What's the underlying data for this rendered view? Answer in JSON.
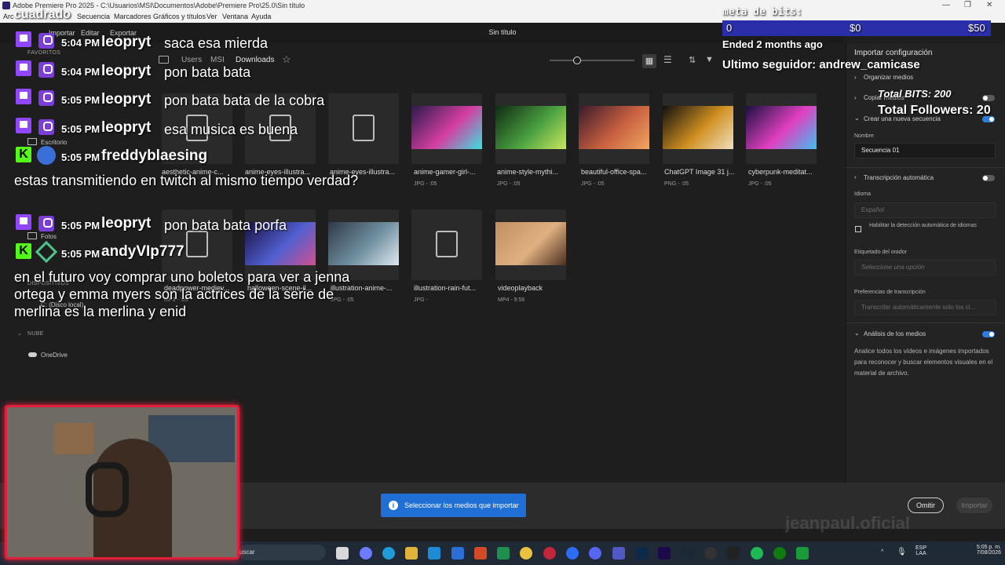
{
  "window": {
    "title": "Adobe Premiere Pro 2025 - C:\\Usuarios\\MSI\\Documentos\\Adobe\\Premiere Pro\\25.0\\Sin título",
    "doc_title": "Sin título",
    "minimize": "—",
    "maximize": "❐",
    "close": "✕"
  },
  "menubar": {
    "items": [
      "Arc",
      "Secuencia",
      "Marcadores",
      "Gráficos y títulos",
      "Ver",
      "Ventana",
      "Ayuda"
    ]
  },
  "tabs": [
    "Importar",
    "Editar",
    "Exportar"
  ],
  "sidebar": {
    "favorites_label": "FAVORITOS",
    "items": [
      "Escritorio",
      "Fotos"
    ],
    "devices_label": "DISPOSITIVOS",
    "device": "C: (Disco local)",
    "cloud_label": "NUBE",
    "cloud_item": "OneDrive"
  },
  "breadcrumb": [
    "Users",
    "MSI",
    "Downloads"
  ],
  "files": [
    {
      "name": "aesthetic-anime-c...",
      "meta": "",
      "kind": "doc"
    },
    {
      "name": "anime-eyes-illustra...",
      "meta": "",
      "kind": "doc"
    },
    {
      "name": "anime-eyes-illustra...",
      "meta": "",
      "kind": "image-placeholder"
    },
    {
      "name": "anime-gamer-girl-...",
      "meta": "JPG - :05",
      "kind": "thumb",
      "colors": [
        "#2a1a4a",
        "#d43fa0",
        "#3be0e0"
      ]
    },
    {
      "name": "anime-style-mythi...",
      "meta": "JPG - :05",
      "kind": "thumb",
      "colors": [
        "#0e2a12",
        "#4aa040",
        "#c8e860"
      ]
    },
    {
      "name": "beautiful-office-spa...",
      "meta": "JPG - :05",
      "kind": "thumb",
      "colors": [
        "#3a1a2a",
        "#c86040",
        "#f0a860"
      ]
    },
    {
      "name": "ChatGPT Image 31 j...",
      "meta": "PNG - :05",
      "kind": "thumb",
      "colors": [
        "#101010",
        "#d09020",
        "#f0e0c0"
      ]
    },
    {
      "name": "cyberpunk-meditat...",
      "meta": "JPG - :05",
      "kind": "thumb",
      "colors": [
        "#1a1040",
        "#e040c0",
        "#40c0f0"
      ]
    },
    {
      "name": "deadpower-mediev...",
      "meta": "MP3 - :05",
      "kind": "audio"
    },
    {
      "name": "halloween-scene-il...",
      "meta": "",
      "kind": "thumb",
      "colors": [
        "#1a1040",
        "#5060d0",
        "#d05090"
      ]
    },
    {
      "name": "illustration-anime-...",
      "meta": "JPG - :05",
      "kind": "thumb",
      "colors": [
        "#303848",
        "#7090a0",
        "#e0e8f0"
      ]
    },
    {
      "name": "illustration-rain-fut...",
      "meta": "JPG -",
      "kind": "image-placeholder"
    },
    {
      "name": "videoplayback",
      "meta": "MP4 - 9:56",
      "kind": "thumb",
      "colors": [
        "#c09060",
        "#e0b080",
        "#4a3020"
      ]
    }
  ],
  "panel": {
    "title": "Importar configuración",
    "organize": "Organizar medios",
    "copy": "Copiar medios",
    "new_sequence": "Crear una nueva secuencia",
    "name_label": "Nombre",
    "name_value": "Secuencia 01",
    "transcription": "Transcripción automática",
    "language_label": "Idioma",
    "language_value": "Español",
    "auto_detect": "Habilitar la detección automática de idiomas",
    "speaker_label": "Etiquetado del orador",
    "speaker_value": "Seleccione una opción",
    "prefs_label": "Preferencias de transcripción",
    "prefs_value": "Transcribir automáticamente solo los cl...",
    "analysis": "Análisis de los medios",
    "analysis_desc": "Analice todos los vídeos e imágenes importados para reconocer y buscar elementos visuales en el material de archivo."
  },
  "bottom": {
    "toast": "Seleccionar los medios que importar",
    "omit": "Omitir",
    "import": "Importar"
  },
  "taskbar": {
    "search": "uscar",
    "lang1": "ESP",
    "lang2": "LAA",
    "time": "5:05 p. m.",
    "date": "7/08/2026"
  },
  "overlay": {
    "top_left": "cuadrado",
    "bits_label": "meta de bits:",
    "bits_start": "0",
    "bits_mid": "$0",
    "bits_end": "$50",
    "ended": "Ended 2 months ago",
    "last_follower": "Ultimo seguidor: andrew_camicase",
    "total_bits": "Total BITS: 200",
    "total_followers": "Total Followers: 20",
    "watermark": "jeanpaul.oficial",
    "chat": [
      {
        "platform": "twitch",
        "time": "5:04 PM",
        "user": "leopryt",
        "msg": "saca esa mierda"
      },
      {
        "platform": "twitch",
        "time": "5:04 PM",
        "user": "leopryt",
        "msg": "pon bata bata"
      },
      {
        "platform": "twitch",
        "time": "5:05 PM",
        "user": "leopryt",
        "msg": "pon bata bata de la cobra"
      },
      {
        "platform": "twitch",
        "time": "5:05 PM",
        "user": "leopryt",
        "msg": "esa musica es buena"
      },
      {
        "platform": "kick",
        "time": "5:05 PM",
        "user": "freddyblaesing",
        "msg": "estas transmitiendo en twitch al mismo tiempo verdad?"
      },
      {
        "platform": "twitch",
        "time": "5:05 PM",
        "user": "leopryt",
        "msg": "pon bata bata porfa"
      },
      {
        "platform": "kick",
        "time": "5:05 PM",
        "user": "andyVIp777",
        "msg": "en el futuro voy comprar uno boletos para ver a jenna ortega y emma myers son la actrices de la serie de merlina es la merlina y enid"
      }
    ]
  }
}
